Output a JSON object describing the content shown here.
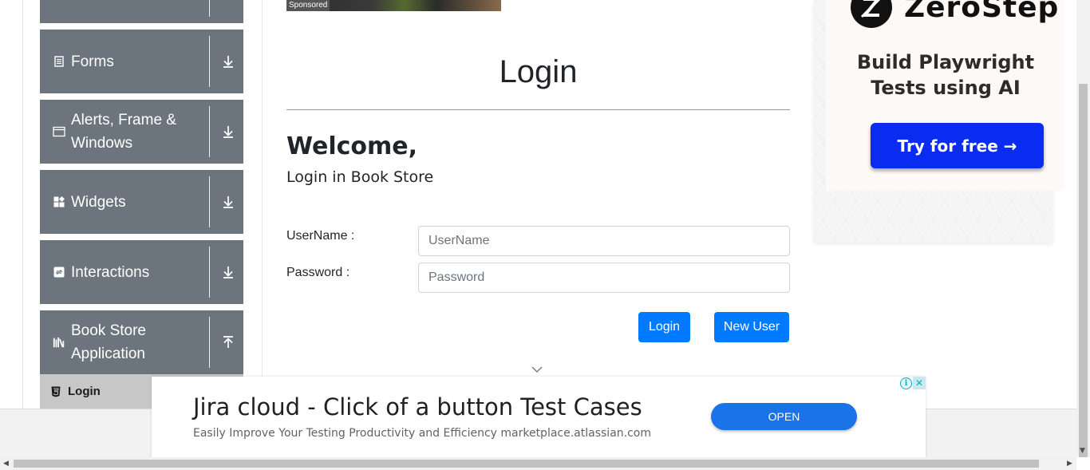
{
  "sidebar": {
    "groups": [
      {
        "label": "Forms",
        "icon": "document-icon",
        "arrow": "down"
      },
      {
        "label": "Alerts, Frame & Windows",
        "icon": "window-icon",
        "arrow": "down"
      },
      {
        "label": "Widgets",
        "icon": "widgets-icon",
        "arrow": "down"
      },
      {
        "label": "Interactions",
        "icon": "interactions-icon",
        "arrow": "down"
      },
      {
        "label": "Book Store Application",
        "icon": "books-icon",
        "arrow": "up"
      }
    ],
    "active_item": {
      "label": "Login",
      "icon": "html5-icon"
    }
  },
  "top_ad": {
    "sponsored": "Sponsored"
  },
  "main": {
    "header": "Login",
    "welcome": "Welcome,",
    "subtitle": "Login in Book Store",
    "username_label": "UserName :",
    "username_placeholder": "UserName",
    "username_value": "",
    "password_label": "Password :",
    "password_placeholder": "Password",
    "password_value": "",
    "login_button": "Login",
    "new_user_button": "New User"
  },
  "side_ad": {
    "brand": "ZeroStep",
    "headline_line1": "Build Playwright",
    "headline_line2": "Tests using AI",
    "cta": "Try for free →"
  },
  "bottom_ad": {
    "title": "Jira cloud - Click of a button Test Cases",
    "subtitle": "Easily Improve Your Testing Productivity and Efficiency marketplace.atlassian.com",
    "button": "OPEN",
    "adchoices": "i",
    "close": "✕"
  },
  "colors": {
    "sidebar_group_bg": "#6c757d",
    "active_item_bg": "#c7c7c7",
    "primary_button": "#007bff",
    "ad_cta": "#0a2cf0",
    "banner_button": "#1a73e8"
  }
}
